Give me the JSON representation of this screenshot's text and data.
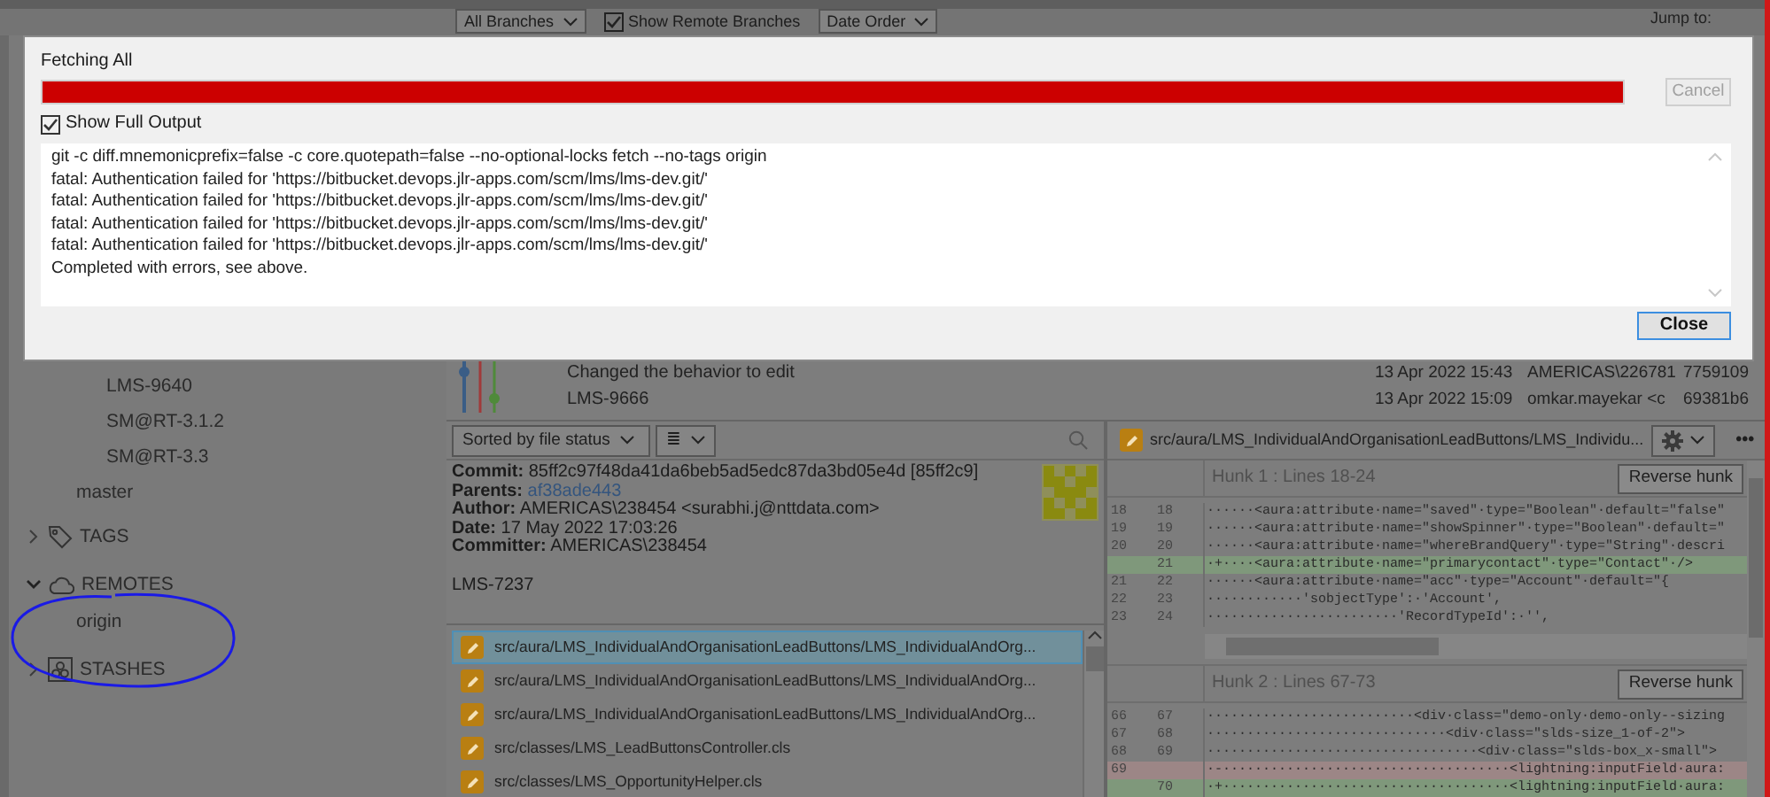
{
  "toolbar": {
    "branch_filter": "All Branches",
    "show_remote_branches": {
      "label": "Show Remote Branches",
      "checked": true
    },
    "sort_order": "Date Order",
    "jump_label": "Jump to:"
  },
  "sidebar": {
    "branch_folder": {
      "children": [
        {
          "label": "LMS-9640"
        },
        {
          "label": "SM@RT-3.1.2"
        },
        {
          "label": "SM@RT-3.3"
        }
      ]
    },
    "branches": [
      {
        "label": "master"
      }
    ],
    "sections": [
      {
        "kind": "tags",
        "label": "TAGS",
        "expanded": false
      },
      {
        "kind": "remotes",
        "label": "REMOTES",
        "expanded": true,
        "children": [
          {
            "label": "origin"
          }
        ]
      },
      {
        "kind": "stashes",
        "label": "STASHES",
        "expanded": false
      }
    ]
  },
  "commits": [
    {
      "message": "Changed the behavior to edit",
      "date": "13 Apr 2022 15:43",
      "author": "AMERICAS\\226781",
      "hash": "7759109"
    },
    {
      "message": "LMS-9666",
      "date": "13 Apr 2022 15:09",
      "author": "omkar.mayekar <c",
      "hash": "69381b6"
    }
  ],
  "file_panel": {
    "sort": "Sorted by file status",
    "view_icon": "≣"
  },
  "commit_details": {
    "fields": [
      {
        "label": "Commit:",
        "value": "85ff2c97f48da41da6beb5ad5edc87da3bd05e4d [85ff2c9]",
        "kind": "text"
      },
      {
        "label": "Parents:",
        "value": "af38ade443",
        "kind": "link"
      },
      {
        "label": "Author:",
        "value": "AMERICAS\\238454 <surabhi.j@nttdata.com>",
        "kind": "text"
      },
      {
        "label": "Date:",
        "value": "17 May 2022 17:03:26",
        "kind": "text"
      },
      {
        "label": "Committer:",
        "value": "AMERICAS\\238454",
        "kind": "text"
      }
    ],
    "message": "LMS-7237"
  },
  "files": [
    {
      "path": "src/aura/LMS_IndividualAndOrganisationLeadButtons/LMS_IndividualAndOrg...",
      "selected": true
    },
    {
      "path": "src/aura/LMS_IndividualAndOrganisationLeadButtons/LMS_IndividualAndOrg...",
      "selected": false
    },
    {
      "path": "src/aura/LMS_IndividualAndOrganisationLeadButtons/LMS_IndividualAndOrg...",
      "selected": false
    },
    {
      "path": "src/classes/LMS_LeadButtonsController.cls",
      "selected": false
    },
    {
      "path": "src/classes/LMS_OpportunityHelper.cls",
      "selected": false
    }
  ],
  "diff": {
    "file": "src/aura/LMS_IndividualAndOrganisationLeadButtons/LMS_Individu...",
    "more": "•••",
    "hunks": [
      {
        "title": "Hunk 1 : Lines 18-24",
        "button": "Reverse hunk",
        "lines": [
          {
            "old": "18",
            "new": "18",
            "kind": "context",
            "text": "······<aura:attribute·name=\"saved\"·type=\"Boolean\"·default=\"false\""
          },
          {
            "old": "19",
            "new": "19",
            "kind": "context",
            "text": "······<aura:attribute·name=\"showSpinner\"·type=\"Boolean\"·default=\""
          },
          {
            "old": "20",
            "new": "20",
            "kind": "context",
            "text": "······<aura:attribute·name=\"whereBrandQuery\"·type=\"String\"·descri"
          },
          {
            "new": "21",
            "kind": "added",
            "text": "·+····<aura:attribute·name=\"primarycontact\"·type=\"Contact\"·/>"
          },
          {
            "old": "21",
            "new": "22",
            "kind": "context",
            "text": "······<aura:attribute·name=\"acc\"·type=\"Account\"·default=\"{"
          },
          {
            "old": "22",
            "new": "23",
            "kind": "context",
            "text": "············'sobjectType':·'Account',"
          },
          {
            "old": "23",
            "new": "24",
            "kind": "context",
            "text": "························'RecordTypeId':·'',"
          }
        ]
      },
      {
        "title": "Hunk 2 : Lines 67-73",
        "button": "Reverse hunk",
        "lines": [
          {
            "old": "66",
            "new": "67",
            "kind": "context",
            "text": "··························<div·class=\"demo-only·demo-only--sizing"
          },
          {
            "old": "67",
            "new": "68",
            "kind": "context",
            "text": "······························<div·class=\"slds-size_1-of-2\">"
          },
          {
            "old": "68",
            "new": "69",
            "kind": "context",
            "text": "··································<div·class=\"slds-box_x-small\">"
          },
          {
            "old": "69",
            "kind": "removed",
            "text": "·-····································<lightning:inputField·aura:"
          },
          {
            "new": "70",
            "kind": "added",
            "text": "·+····································<lightning:inputField·aura:"
          }
        ]
      }
    ]
  },
  "dialog": {
    "title": "Fetching All",
    "progress": {
      "level": 1
    },
    "cancel": {
      "label": "Cancel",
      "disabled": true
    },
    "show_full_output": {
      "label": "Show Full Output",
      "checked": true
    },
    "output": [
      "git -c diff.mnemonicprefix=false -c core.quotepath=false --no-optional-locks fetch --no-tags origin",
      "fatal: Authentication failed for 'https://bitbucket.devops.jlr-apps.com/scm/lms/lms-dev.git/'",
      "fatal: Authentication failed for 'https://bitbucket.devops.jlr-apps.com/scm/lms/lms-dev.git/'",
      "fatal: Authentication failed for 'https://bitbucket.devops.jlr-apps.com/scm/lms/lms-dev.git/'",
      "fatal: Authentication failed for 'https://bitbucket.devops.jlr-apps.com/scm/lms/lms-dev.git/'",
      "Completed with errors, see above."
    ],
    "close": "Close"
  }
}
